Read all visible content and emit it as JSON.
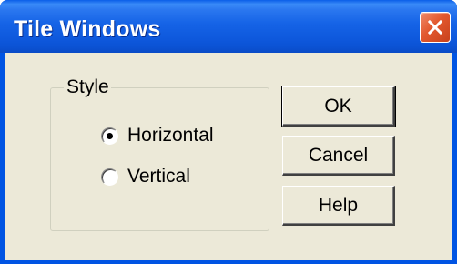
{
  "window": {
    "title": "Tile Windows"
  },
  "titlebar": {
    "close_icon": "close-x-icon",
    "colors": {
      "titlebar": "#0054e3",
      "close_button": "#e2582e",
      "client": "#ece9d8"
    }
  },
  "group": {
    "label": "Style",
    "options": [
      {
        "label": "Horizontal",
        "checked": true
      },
      {
        "label": "Vertical",
        "checked": false
      }
    ]
  },
  "buttons": {
    "ok": "OK",
    "cancel": "Cancel",
    "help": "Help"
  }
}
